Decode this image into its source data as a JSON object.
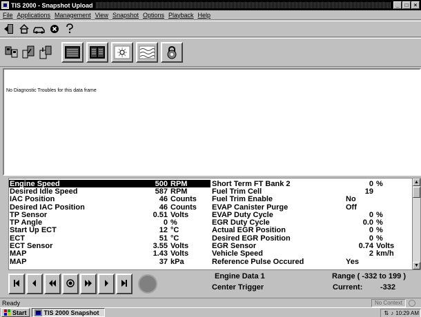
{
  "window": {
    "title": "TIS 2000 - Snapshot Upload",
    "controls": [
      "_",
      "□",
      "×"
    ]
  },
  "menu": [
    "File",
    "Applications",
    "Management",
    "View",
    "Snapshot",
    "Options",
    "Playback",
    "Help"
  ],
  "toolbar1": [
    "exit-icon",
    "home-icon",
    "vehicle-icon",
    "stop-icon",
    "help-icon"
  ],
  "toolbar2": [
    "tech-tool-icon",
    "upload-icon",
    "download-icon",
    "single-column-icon",
    "dual-column-icon",
    "dtc-icon",
    "graph-icon",
    "lock-icon"
  ],
  "diagnostics": {
    "message": "No Diagnostic Troubles for this data frame"
  },
  "left_params": [
    {
      "name": "Engine Speed",
      "value": "500",
      "unit": "RPM",
      "selected": true
    },
    {
      "name": "Desired Idle Speed",
      "value": "587",
      "unit": "RPM"
    },
    {
      "name": "IAC Position",
      "value": "46",
      "unit": "Counts"
    },
    {
      "name": "Desired IAC Position",
      "value": "46",
      "unit": "Counts"
    },
    {
      "name": "TP Sensor",
      "value": "0.51",
      "unit": "Volts"
    },
    {
      "name": "TP Angle",
      "value": "0",
      "unit": "%"
    },
    {
      "name": "Start Up ECT",
      "value": "12",
      "unit": "°C"
    },
    {
      "name": "ECT",
      "value": "51",
      "unit": "°C"
    },
    {
      "name": "ECT Sensor",
      "value": "3.55",
      "unit": "Volts"
    },
    {
      "name": "MAP",
      "value": "1.43",
      "unit": "Volts"
    },
    {
      "name": "MAP",
      "value": "37",
      "unit": "kPa"
    }
  ],
  "right_params": [
    {
      "name": "Short Term FT Bank 2",
      "value": "0",
      "unit": "%"
    },
    {
      "name": "Fuel Trim Cell",
      "value": "19",
      "unit": ""
    },
    {
      "name": "Fuel Trim Enable",
      "value": "No",
      "unit": "",
      "text": true
    },
    {
      "name": "EVAP Canister Purge",
      "value": "Off",
      "unit": "",
      "text": true
    },
    {
      "name": "EVAP Duty Cycle",
      "value": "0",
      "unit": "%"
    },
    {
      "name": "EGR Duty Cycle",
      "value": "0.0",
      "unit": "%"
    },
    {
      "name": "Actual EGR Position",
      "value": "0",
      "unit": "%"
    },
    {
      "name": "Desired EGR Position",
      "value": "0",
      "unit": "%"
    },
    {
      "name": "EGR Sensor",
      "value": "0.74",
      "unit": "Volts"
    },
    {
      "name": "Vehicle Speed",
      "value": "2",
      "unit": "km/h"
    },
    {
      "name": "Reference Pulse Occured",
      "value": "Yes",
      "unit": "",
      "text": true
    }
  ],
  "playback": {
    "buttons": [
      "⏮",
      "◀",
      "◀◀",
      "◉",
      "▶▶",
      "▶",
      "⏭"
    ],
    "data_label": "Engine Data 1",
    "trigger_label": "Center Trigger",
    "range_label": "Range ( -332 to 199 )",
    "current_label": "Current:",
    "current_value": "-332"
  },
  "status": {
    "text": "Ready",
    "context": "No Context"
  },
  "taskbar": {
    "start": "Start",
    "task": "TIS 2000 Snapshot",
    "time": "10:29 AM"
  }
}
